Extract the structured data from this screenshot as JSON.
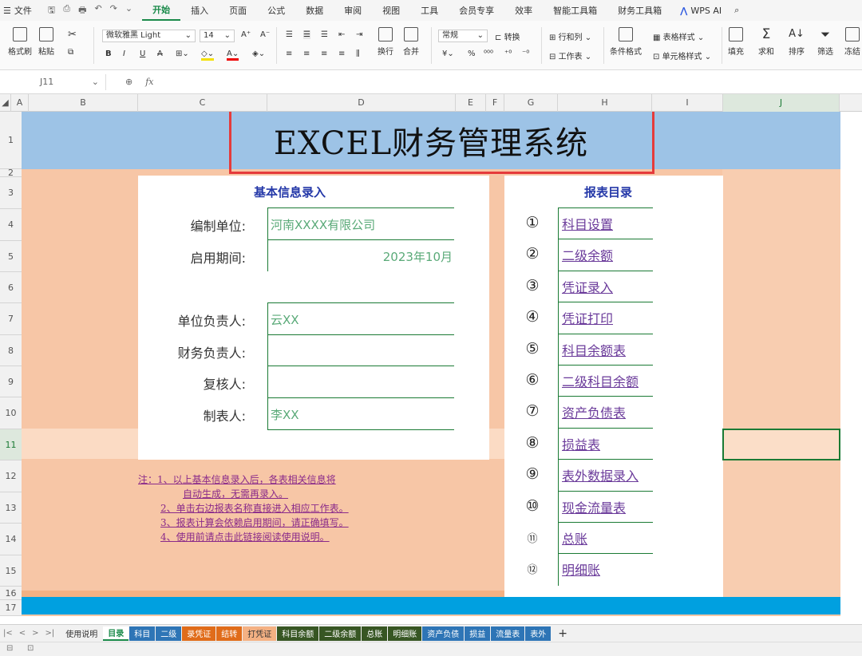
{
  "menubar": {
    "file_label": "文件",
    "tabs": [
      {
        "label": "开始",
        "active": true
      },
      {
        "label": "插入"
      },
      {
        "label": "页面"
      },
      {
        "label": "公式"
      },
      {
        "label": "数据"
      },
      {
        "label": "审阅"
      },
      {
        "label": "视图"
      },
      {
        "label": "工具"
      },
      {
        "label": "会员专享"
      },
      {
        "label": "效率"
      },
      {
        "label": "智能工具箱"
      },
      {
        "label": "财务工具箱"
      }
    ],
    "wps_ai": "WPS AI",
    "accent": "#1a8a4a"
  },
  "ribbon": {
    "format_painter": "格式刷",
    "paste": "粘贴",
    "font_name": "微软雅黑 Light",
    "font_size": "14",
    "number_format": "常规",
    "convert": "转换",
    "rows_cols": "行和列",
    "table_style": "表格样式",
    "worksheet": "工作表",
    "conditional_format": "条件格式",
    "cell_style": "单元格样式",
    "wrap": "换行",
    "merge": "合并",
    "fill": "填充",
    "sum": "求和",
    "sort": "排序",
    "filter": "筛选",
    "freeze": "冻结"
  },
  "formula_bar": {
    "cell_ref": "J11",
    "fx": "fx"
  },
  "columns": [
    "A",
    "B",
    "C",
    "D",
    "E",
    "F",
    "G",
    "H",
    "I",
    "J"
  ],
  "rows": [
    "1",
    "2",
    "3",
    "4",
    "5",
    "6",
    "7",
    "8",
    "9",
    "10",
    "11",
    "12",
    "13",
    "14",
    "15",
    "16",
    "17"
  ],
  "sheet": {
    "title": "EXCEL财务管理系统",
    "left_panel": {
      "title": "基本信息录入",
      "fields": [
        {
          "label": "编制单位:",
          "value": "河南XXXX有限公司"
        },
        {
          "label": "启用期间:",
          "value": "2023年10月"
        },
        {
          "label": "单位负责人:",
          "value": "云XX"
        },
        {
          "label": "财务负责人:",
          "value": ""
        },
        {
          "label": "复核人:",
          "value": ""
        },
        {
          "label": "制表人:",
          "value": "李XX"
        }
      ]
    },
    "right_panel": {
      "title": "报表目录",
      "items": [
        {
          "num": "①",
          "label": "科目设置"
        },
        {
          "num": "②",
          "label": "二级余额"
        },
        {
          "num": "③",
          "label": "凭证录入"
        },
        {
          "num": "④",
          "label": "凭证打印"
        },
        {
          "num": "⑤",
          "label": "科目余额表"
        },
        {
          "num": "⑥",
          "label": "二级科目余额"
        },
        {
          "num": "⑦",
          "label": "资产负债表"
        },
        {
          "num": "⑧",
          "label": "损益表"
        },
        {
          "num": "⑨",
          "label": "表外数据录入"
        },
        {
          "num": "⑩",
          "label": "现金流量表"
        },
        {
          "num": "⑪",
          "label": "总账"
        },
        {
          "num": "⑫",
          "label": "明细账"
        }
      ]
    },
    "notes": [
      "注：1、以上基本信息录入后，各表相关信息将",
      "自动生成，无需再录入。",
      "2、单击右边报表名称直接进入相应工作表。",
      "3、报表计算会依赖启用期间，请正确填写。",
      "4、使用前请点击此链接阅读使用说明。"
    ]
  },
  "sheet_tabs": [
    {
      "label": "使用说明",
      "color": "#f1f1f1",
      "text": "#333"
    },
    {
      "label": "目录",
      "color": "#ffffff",
      "text": "#1a8a4a",
      "active": true
    },
    {
      "label": "科目",
      "color": "#2e75b6",
      "text": "#fff"
    },
    {
      "label": "二级",
      "color": "#2e75b6",
      "text": "#fff"
    },
    {
      "label": "录凭证",
      "color": "#e06c1a",
      "text": "#fff"
    },
    {
      "label": "结转",
      "color": "#e06c1a",
      "text": "#fff"
    },
    {
      "label": "打凭证",
      "color": "#f4b183",
      "text": "#333"
    },
    {
      "label": "科目余额",
      "color": "#375623",
      "text": "#fff"
    },
    {
      "label": "二级余额",
      "color": "#375623",
      "text": "#fff"
    },
    {
      "label": "总账",
      "color": "#375623",
      "text": "#fff"
    },
    {
      "label": "明细账",
      "color": "#375623",
      "text": "#fff"
    },
    {
      "label": "资产负债",
      "color": "#2e75b6",
      "text": "#fff"
    },
    {
      "label": "损益",
      "color": "#2e75b6",
      "text": "#fff"
    },
    {
      "label": "流量表",
      "color": "#2e75b6",
      "text": "#fff"
    },
    {
      "label": "表外",
      "color": "#2e75b6",
      "text": "#fff"
    }
  ],
  "add_sheet": "+"
}
